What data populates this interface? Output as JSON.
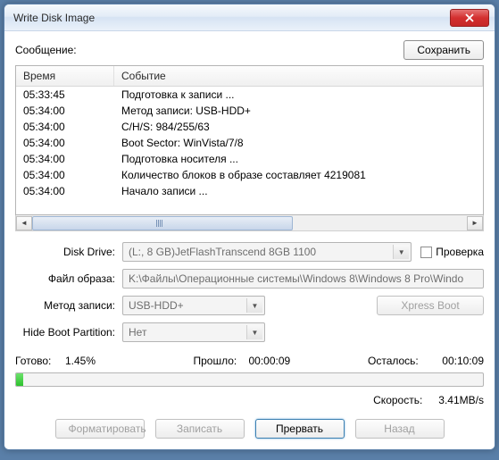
{
  "window": {
    "title": "Write Disk Image"
  },
  "top": {
    "message_label": "Сообщение:",
    "save_label": "Сохранить"
  },
  "listview": {
    "col_time": "Время",
    "col_event": "Событие",
    "rows": [
      {
        "time": "05:33:45",
        "event": "Подготовка к записи ..."
      },
      {
        "time": "05:34:00",
        "event": "Метод записи: USB-HDD+"
      },
      {
        "time": "05:34:00",
        "event": "C/H/S: 984/255/63"
      },
      {
        "time": "05:34:00",
        "event": "Boot Sector: WinVista/7/8"
      },
      {
        "time": "05:34:00",
        "event": "Подготовка носителя ..."
      },
      {
        "time": "05:34:00",
        "event": "Количество блоков в образе составляет 4219081"
      },
      {
        "time": "05:34:00",
        "event": "Начало записи ..."
      }
    ]
  },
  "form": {
    "disk_drive_label": "Disk Drive:",
    "disk_drive_value": "(L:, 8 GB)JetFlashTranscend 8GB   1100",
    "check_label": "Проверка",
    "image_label": "Файл образа:",
    "image_value": "K:\\Файлы\\Операционные системы\\Windows 8\\Windows 8 Pro\\Windo",
    "method_label": "Метод записи:",
    "method_value": "USB-HDD+",
    "xpress_label": "Xpress Boot",
    "hide_label": "Hide Boot Partition:",
    "hide_value": "Нет"
  },
  "status": {
    "done_label": "Готово:",
    "done_value": "1.45%",
    "elapsed_label": "Прошло:",
    "elapsed_value": "00:00:09",
    "remain_label": "Осталось:",
    "remain_value": "00:10:09",
    "progress_percent": 1.45,
    "speed_label": "Скорость:",
    "speed_value": "3.41MB/s"
  },
  "buttons": {
    "format": "Форматировать",
    "write": "Записать",
    "abort": "Прервать",
    "back": "Назад"
  }
}
